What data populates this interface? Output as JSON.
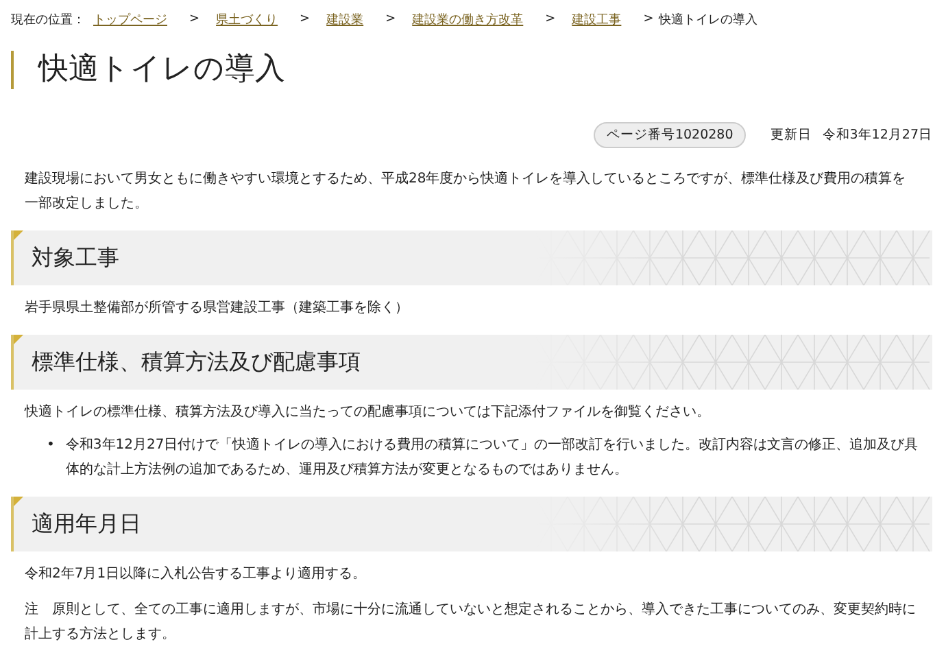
{
  "breadcrumb": {
    "label": "現在の位置：",
    "links": [
      {
        "text": "トップページ"
      },
      {
        "text": "県土づくり"
      },
      {
        "text": "建設業"
      },
      {
        "text": "建設業の働き方改革"
      },
      {
        "text": "建設工事"
      }
    ],
    "separator": ">",
    "current": "快適トイレの導入"
  },
  "title": "快適トイレの導入",
  "meta": {
    "page_number": "ページ番号1020280",
    "updated_label": "更新日",
    "updated_date": "令和3年12月27日"
  },
  "intro": "建設現場において男女ともに働きやすい環境とするため、平成28年度から快適トイレを導入しているところですが、標準仕様及び費用の積算を一部改定しました。",
  "sections": [
    {
      "heading": "対象工事",
      "blocks": [
        {
          "kind": "paragraph",
          "text": "岩手県県土整備部が所管する県営建設工事（建築工事を除く）"
        }
      ]
    },
    {
      "heading": "標準仕様、積算方法及び配慮事項",
      "blocks": [
        {
          "kind": "paragraph",
          "text": "快適トイレの標準仕様、積算方法及び導入に当たっての配慮事項については下記添付ファイルを御覧ください。"
        },
        {
          "kind": "bullet",
          "marker": "•",
          "text": "令和3年12月27日付けで「快適トイレの導入における費用の積算について」の一部改訂を行いました。改訂内容は文言の修正、追加及び具体的な計上方法例の追加であるため、運用及び積算方法が変更となるものではありません。"
        }
      ]
    },
    {
      "heading": "適用年月日",
      "blocks": [
        {
          "kind": "paragraph",
          "text": "令和2年7月1日以降に入札公告する工事より適用する。"
        },
        {
          "kind": "paragraph",
          "text": "注　原則として、全ての工事に適用しますが、市場に十分に流通していないと想定されることから、導入できた工事についてのみ、変更契約時に計上する方法とします。"
        }
      ]
    }
  ]
}
